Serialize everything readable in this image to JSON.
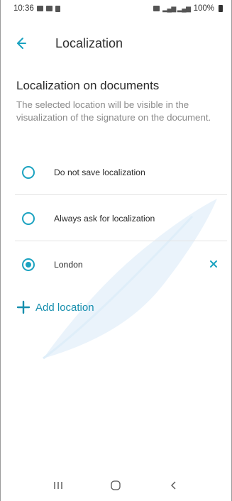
{
  "status_bar": {
    "time": "10:36",
    "battery": "100%"
  },
  "app_bar": {
    "title": "Localization"
  },
  "section": {
    "title": "Localization on documents",
    "description": "The selected location will be visible in the visualization of the signature on the document."
  },
  "options": [
    {
      "label": "Do not save localization",
      "selected": false
    },
    {
      "label": "Always ask for localization",
      "selected": false
    },
    {
      "label": "London",
      "selected": true
    }
  ],
  "add_location": {
    "label": "Add location"
  },
  "colors": {
    "accent": "#1aa2c0",
    "watermark": "#e9f3fb"
  }
}
